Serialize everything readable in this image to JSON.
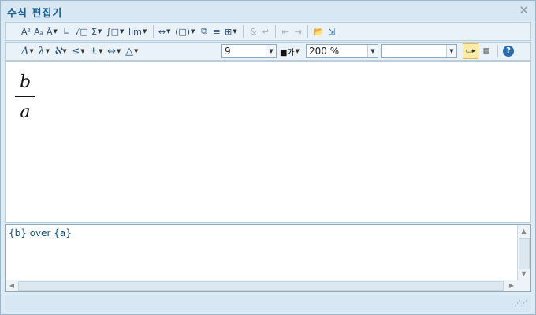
{
  "window": {
    "title": "수식 편집기",
    "close_glyph": "✕"
  },
  "toolbar1": {
    "items": [
      {
        "name": "superscript-button",
        "glyph": "A²"
      },
      {
        "name": "subscript-button",
        "glyph": "Aₐ"
      },
      {
        "name": "decoration-button",
        "glyph": "Ā"
      },
      {
        "name": "fraction-button",
        "glyph": "⌸"
      },
      {
        "name": "root-button",
        "glyph": "√□"
      },
      {
        "name": "sum-button",
        "glyph": "Σ"
      },
      {
        "name": "integral-button",
        "glyph": "∫□"
      },
      {
        "name": "limit-button",
        "glyph": "lim"
      },
      {
        "name": "long-arrow-button",
        "glyph": "⇹"
      },
      {
        "name": "paren-button",
        "glyph": "(□)"
      },
      {
        "name": "matrix-button",
        "glyph": "⧉"
      },
      {
        "name": "lines-button",
        "glyph": "≡"
      },
      {
        "name": "grid-button",
        "glyph": "⊞"
      },
      {
        "name": "align-button",
        "glyph": "&"
      },
      {
        "name": "newline-button",
        "glyph": "↵"
      },
      {
        "name": "prev-button",
        "glyph": "⇤"
      },
      {
        "name": "next-button",
        "glyph": "⇥"
      },
      {
        "name": "open-button",
        "glyph": "📂"
      },
      {
        "name": "insert-button",
        "glyph": "⇲"
      }
    ]
  },
  "toolbar2": {
    "items": [
      {
        "name": "greek-upper-button",
        "glyph": "Λ"
      },
      {
        "name": "greek-lower-button",
        "glyph": "λ"
      },
      {
        "name": "symbols-button",
        "glyph": "ℵ"
      },
      {
        "name": "relation-button",
        "glyph": "≤"
      },
      {
        "name": "operator-button",
        "glyph": "±"
      },
      {
        "name": "arrow-button",
        "glyph": "⇔"
      },
      {
        "name": "misc-button",
        "glyph": "△"
      }
    ],
    "font_size": "9",
    "color_label": "■가",
    "zoom": "200 %",
    "font_name": ""
  },
  "editor": {
    "numerator": "b",
    "denominator": "a"
  },
  "script": {
    "text": "{b} over {a}"
  }
}
